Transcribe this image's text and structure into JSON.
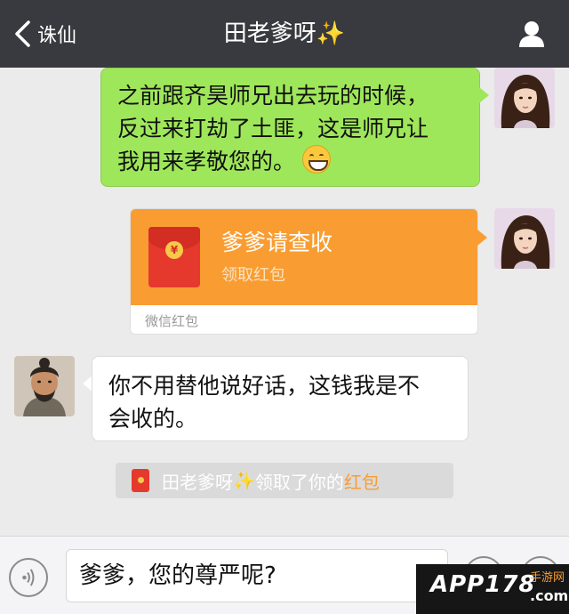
{
  "topbar": {
    "back_label": "诛仙",
    "title": "田老爹呀",
    "title_sparkle": "✨",
    "profile_icon": "person-icon"
  },
  "messages": [
    {
      "side": "right",
      "type": "text",
      "lines": [
        "之前跟齐昊师兄出去玩的时候，",
        "反过来打劫了土匪，这是师兄让",
        "我用来孝敬您的。"
      ],
      "emoji": "grin-emoji"
    },
    {
      "side": "right",
      "type": "red-packet",
      "title": "爹爹请查收",
      "subtitle": "领取红包",
      "footer": "微信红包",
      "coin": "¥"
    },
    {
      "side": "left",
      "type": "text",
      "lines": [
        "你不用替他说好话，这钱我是不",
        "会收的。"
      ]
    }
  ],
  "system_message": {
    "name": "田老爹呀",
    "sparkle": "✨",
    "action": "领取了你的",
    "packet": "红包"
  },
  "input_bar": {
    "text": "爹爹，您的尊严呢?",
    "voice_icon": "voice-icon",
    "emoji_icon": "emoji-icon",
    "plus_icon": "plus-icon"
  },
  "watermark": {
    "main": "APP178",
    "sub_top": "手游网",
    "sub_bottom": ".com"
  },
  "colors": {
    "topbar": "#393a3f",
    "green_bubble": "#9fe75a",
    "red_packet": "#f99d32",
    "background": "#ebebeb"
  }
}
